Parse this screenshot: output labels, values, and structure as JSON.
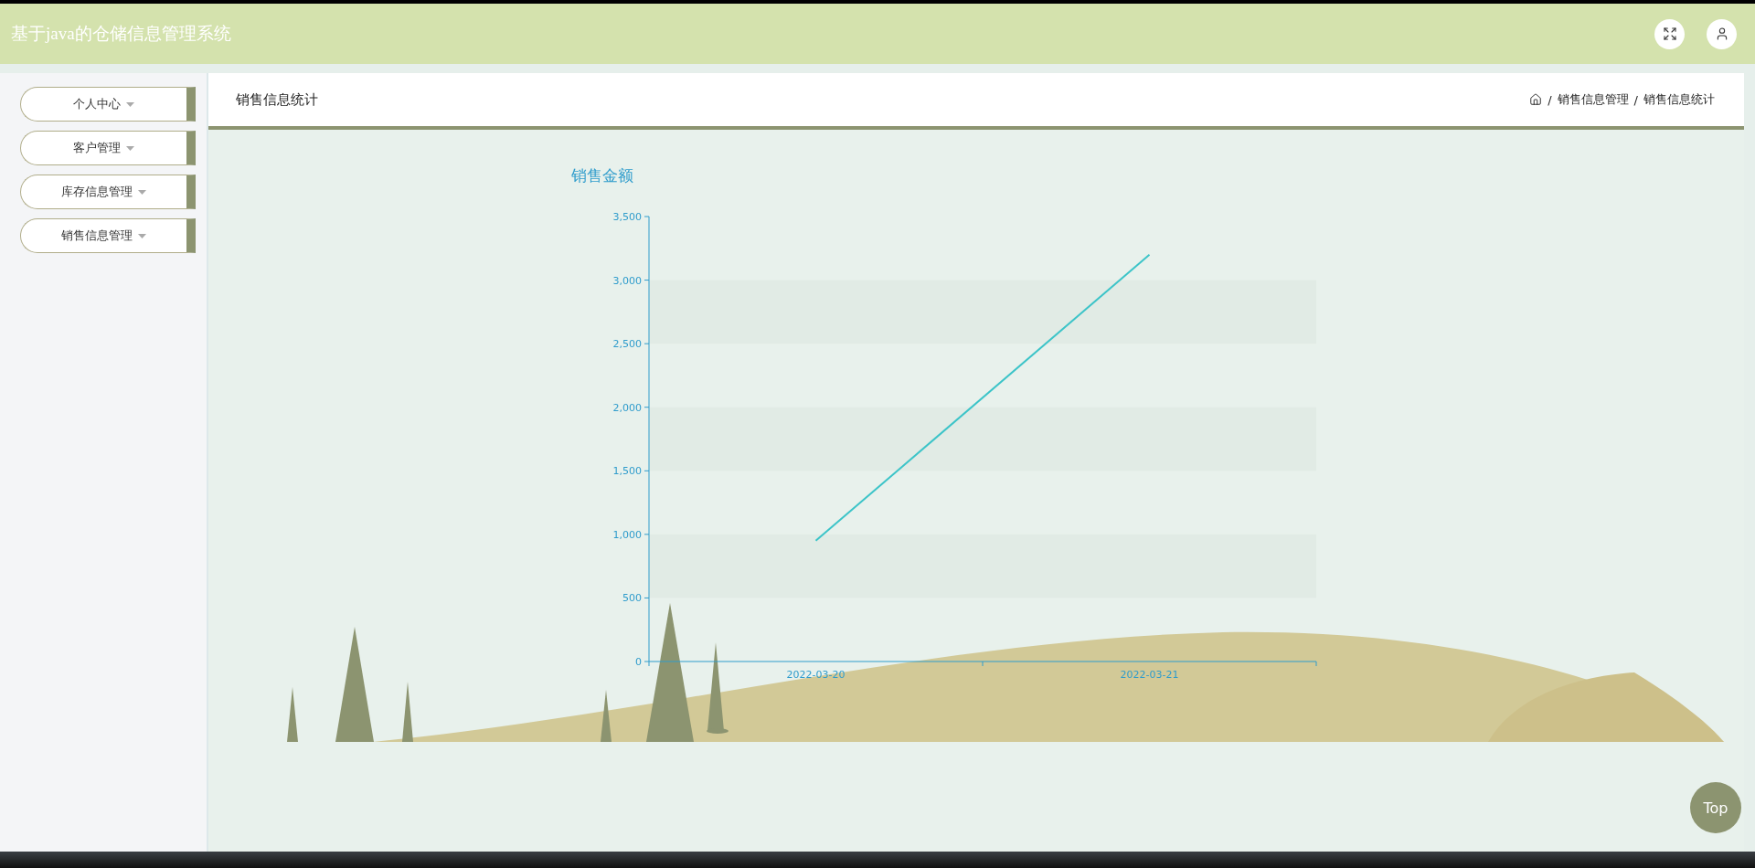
{
  "header": {
    "title": "基于java的仓储信息管理系统"
  },
  "sidebar": {
    "items": [
      {
        "label": "个人中心"
      },
      {
        "label": "客户管理"
      },
      {
        "label": "库存信息管理"
      },
      {
        "label": "销售信息管理"
      }
    ]
  },
  "page": {
    "title": "销售信息统计",
    "breadcrumb": {
      "separator": "/",
      "items": [
        "销售信息管理",
        "销售信息统计"
      ]
    }
  },
  "chart": {
    "chart_data": {
      "type": "line",
      "title": "销售金额",
      "categories": [
        "2022-03-20",
        "2022-03-21"
      ],
      "series": [
        {
          "color": "#3cc4c8",
          "values": [
            950,
            3200
          ]
        }
      ],
      "ylim": [
        0,
        3500
      ],
      "yticks": [
        {
          "value": 0,
          "label": "0"
        },
        {
          "value": 500,
          "label": "500"
        },
        {
          "value": 1000,
          "label": "1,000"
        },
        {
          "value": 1500,
          "label": "1,500"
        },
        {
          "value": 2000,
          "label": "2,000"
        },
        {
          "value": 2500,
          "label": "2,500"
        },
        {
          "value": 3000,
          "label": "3,000"
        },
        {
          "value": 3500,
          "label": "3,500"
        }
      ]
    }
  },
  "back_to_top": "Top"
}
